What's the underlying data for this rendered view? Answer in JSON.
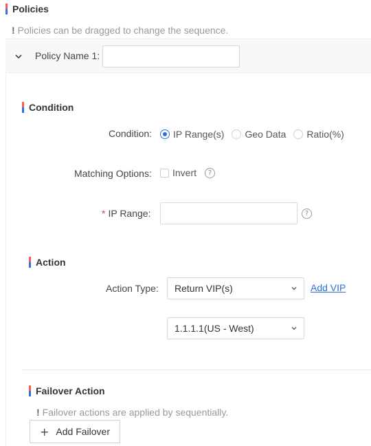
{
  "policies": {
    "title": "Policies",
    "hint": "Policies can be dragged to change the sequence.",
    "hint_mark": "!"
  },
  "policy": {
    "name_label": "Policy Name 1:",
    "name_value": "",
    "expanded": true
  },
  "condition": {
    "title": "Condition",
    "label": "Condition:",
    "options": [
      "IP Range(s)",
      "Geo Data",
      "Ratio(%)"
    ],
    "selected": "IP Range(s)",
    "matching_label": "Matching Options:",
    "invert_label": "Invert",
    "invert_checked": false,
    "help_glyph": "?",
    "required_mark": "*",
    "ip_range_label": "IP Range:",
    "ip_range_value": ""
  },
  "action": {
    "title": "Action",
    "type_label": "Action Type:",
    "type_value": "Return VIP(s)",
    "add_vip": "Add VIP",
    "vip_value": "1.1.1.1(US - West)"
  },
  "failover": {
    "title": "Failover Action",
    "hint_mark": "!",
    "hint": "Failover actions are applied by sequentially.",
    "add_button_icon": "+",
    "add_button": "Add Failover"
  },
  "colors": {
    "accent": "#2f6fe0",
    "bar_top": "#ff5a4f",
    "required": "#e23d3d"
  }
}
